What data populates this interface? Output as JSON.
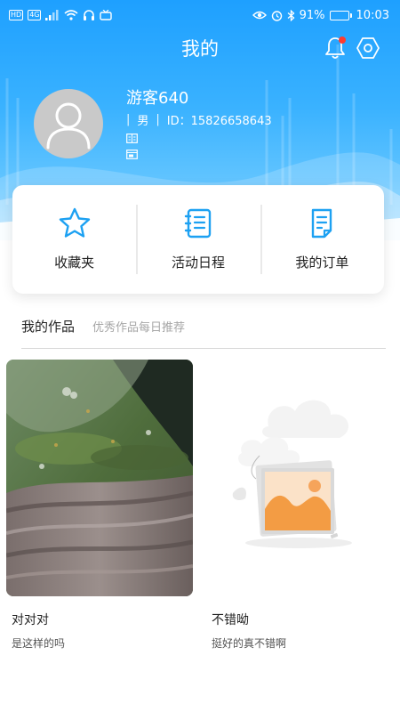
{
  "status_bar": {
    "left_badges": [
      "HD",
      "4G"
    ],
    "battery": "91%",
    "time": "10:03"
  },
  "header": {
    "title": "我的",
    "notification_dot": true
  },
  "profile": {
    "username": "游客640",
    "gender": "男",
    "id_text": "ID：15826658643"
  },
  "quick_actions": [
    {
      "label": "收藏夹",
      "icon": "star-icon"
    },
    {
      "label": "活动日程",
      "icon": "schedule-icon"
    },
    {
      "label": "我的订单",
      "icon": "order-icon"
    }
  ],
  "works": {
    "title": "我的作品",
    "subtitle": "优秀作品每日推荐",
    "items": [
      {
        "title": "对对对",
        "desc": "是这样的吗",
        "image": "nature-photo"
      },
      {
        "title": "不错呦",
        "desc": "挺好的真不错啊",
        "image": "image-placeholder"
      }
    ]
  },
  "colors": {
    "header_top": "#1ea0ff",
    "header_bottom": "#8fd6ff",
    "accent": "#1da1f2",
    "notification_dot": "#ff3b30"
  }
}
